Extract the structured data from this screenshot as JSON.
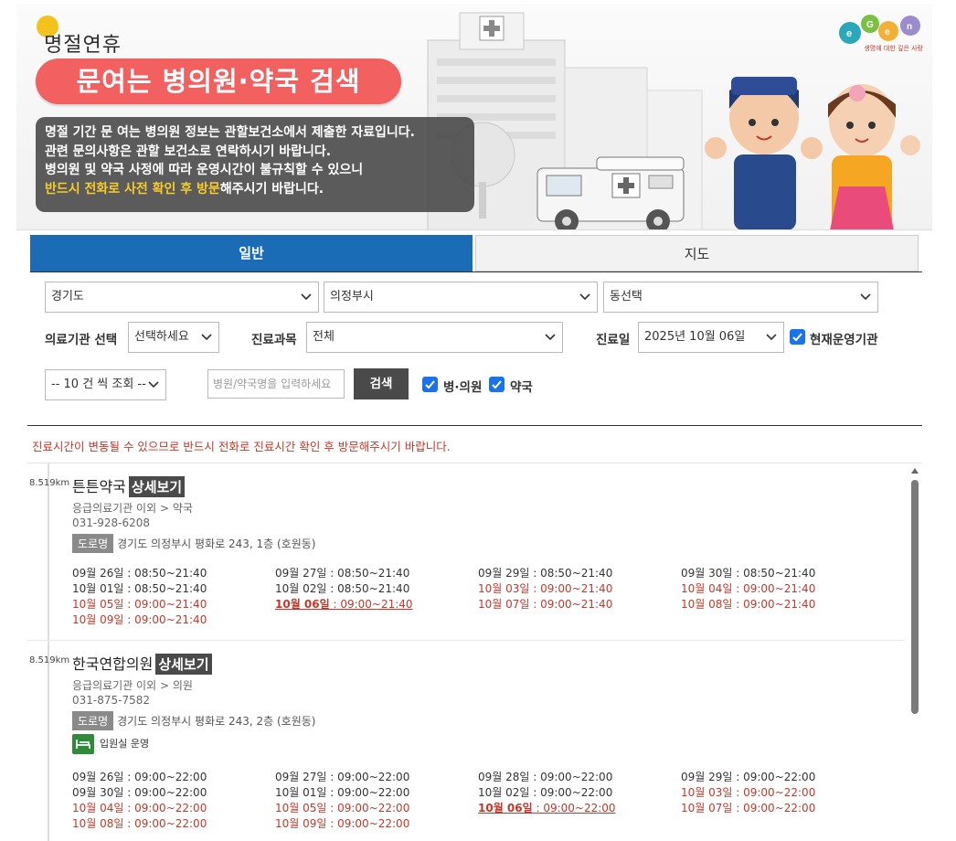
{
  "banner": {
    "holiday_title": "명절연휴",
    "headline": "문여는 병의원·약국 검색",
    "info_lines": [
      "명절 기간 문 여는 병의원 정보는 관할보건소에서 제출한 자료입니다.",
      "관련 문의사항은 관할 보건소로 연락하시기 바랍니다.",
      "병의원 및 약국 사정에 따라 운영시간이 불규칙할 수 있으니"
    ],
    "info_highlight": "반드시 전화로 사전 확인 후 방문",
    "info_tail": "해주시기 바랍니다.",
    "logo_tagline": "생명에 대한 깊은 사랑"
  },
  "tabs": [
    {
      "label": "일반",
      "active": true
    },
    {
      "label": "지도",
      "active": false
    }
  ],
  "filters": {
    "province": "경기도",
    "city": "의정부시",
    "dong": "동선택",
    "org_type_label": "의료기관 선택",
    "org_type_value": "선택하세요",
    "dept_label": "진료과목",
    "dept_value": "전체",
    "date_label": "진료일",
    "date_value": "2025년 10월 06일",
    "current_label": "현재운영기관",
    "page_size": "-- 10 건 씩 조회 --",
    "search_placeholder": "병원/약국명을 입력하세요",
    "search_button": "검색",
    "hospital_label": "병·의원",
    "pharmacy_label": "약국"
  },
  "notice": "진료시간이 변동될 수 있으므로 반드시 전화로 진료시간 확인 후 방문해주시기 바랍니다.",
  "detail_label": "상세보기",
  "road_tag": "도로명",
  "results": [
    {
      "distance": "8.519km",
      "name": "튼튼약국",
      "category": "응급의료기관 이외 > 약국",
      "phone": "031-928-6208",
      "address": "경기도 의정부시 평화로 243, 1층 (호원동)",
      "schedule": [
        {
          "date": "09월 26일",
          "time": " : 08:50~21:40",
          "style": "black"
        },
        {
          "date": "09월 27일",
          "time": " : 08:50~21:40",
          "style": "black"
        },
        {
          "date": "09월 29일",
          "time": " : 08:50~21:40",
          "style": "black"
        },
        {
          "date": "09월 30일",
          "time": " : 08:50~21:40",
          "style": "black"
        },
        {
          "date": "10월 01일",
          "time": " : 08:50~21:40",
          "style": "black"
        },
        {
          "date": "10월 02일",
          "time": " : 08:50~21:40",
          "style": "black"
        },
        {
          "date": "10월 03일",
          "time": " : 09:00~21:40",
          "style": "red"
        },
        {
          "date": "10월 04일",
          "time": " : 09:00~21:40",
          "style": "red"
        },
        {
          "date": "10월 05일",
          "time": " : 09:00~21:40",
          "style": "red"
        },
        {
          "date": "10월 06일",
          "time": " : 09:00~21:40",
          "style": "today"
        },
        {
          "date": "10월 07일",
          "time": " : 09:00~21:40",
          "style": "red"
        },
        {
          "date": "10월 08일",
          "time": " : 09:00~21:40",
          "style": "red"
        },
        {
          "date": "10월 09일",
          "time": " : 09:00~21:40",
          "style": "red"
        }
      ]
    },
    {
      "distance": "8.519km",
      "name": "한국연합의원",
      "category": "응급의료기관 이외 > 의원",
      "phone": "031-875-7582",
      "address": "경기도 의정부시 평화로 243, 2층 (호원동)",
      "ward": "입원실 운영",
      "schedule": [
        {
          "date": "09월 26일",
          "time": " : 09:00~22:00",
          "style": "black"
        },
        {
          "date": "09월 27일",
          "time": " : 09:00~22:00",
          "style": "black"
        },
        {
          "date": "09월 28일",
          "time": " : 09:00~22:00",
          "style": "black"
        },
        {
          "date": "09월 29일",
          "time": " : 09:00~22:00",
          "style": "black"
        },
        {
          "date": "09월 30일",
          "time": " : 09:00~22:00",
          "style": "black"
        },
        {
          "date": "10월 01일",
          "time": " : 09:00~22:00",
          "style": "black"
        },
        {
          "date": "10월 02일",
          "time": " : 09:00~22:00",
          "style": "black"
        },
        {
          "date": "10월 03일",
          "time": " : 09:00~22:00",
          "style": "red"
        },
        {
          "date": "10월 04일",
          "time": " : 09:00~22:00",
          "style": "red"
        },
        {
          "date": "10월 05일",
          "time": " : 09:00~22:00",
          "style": "red"
        },
        {
          "date": "10월 06일",
          "time": " : 09:00~22:00",
          "style": "today"
        },
        {
          "date": "10월 07일",
          "time": " : 09:00~22:00",
          "style": "red"
        },
        {
          "date": "10월 08일",
          "time": " : 09:00~22:00",
          "style": "red"
        },
        {
          "date": "10월 09일",
          "time": " : 09:00~22:00",
          "style": "red"
        }
      ]
    }
  ],
  "colors": {
    "tab_active": "#1a6cb6",
    "headline_pill": "#f26060",
    "highlight": "#f6cc2c",
    "holiday_red": "#c0392b",
    "button_dark": "#4a4a4a",
    "checkbox": "#1a73e8"
  }
}
